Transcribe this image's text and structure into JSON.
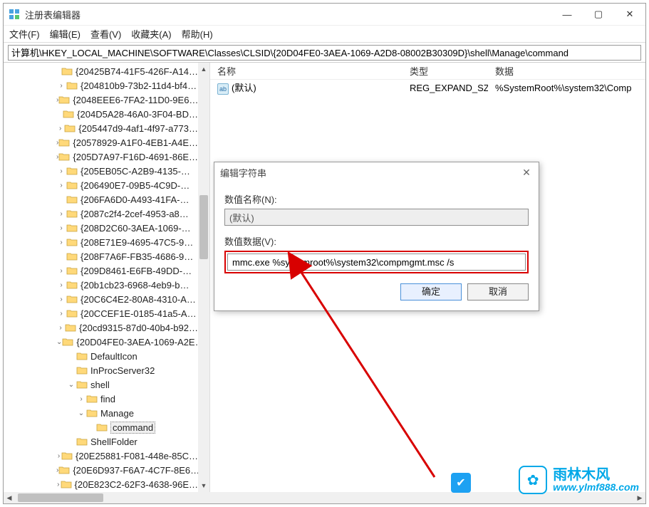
{
  "window": {
    "title": "注册表编辑器",
    "minimize": "—",
    "maximize": "▢",
    "close": "✕"
  },
  "menu": {
    "file": "文件(F)",
    "edit": "编辑(E)",
    "view": "查看(V)",
    "fav": "收藏夹(A)",
    "help": "帮助(H)"
  },
  "path": "计算机\\HKEY_LOCAL_MACHINE\\SOFTWARE\\Classes\\CLSID\\{20D04FE0-3AEA-1069-A2D8-08002B30309D}\\shell\\Manage\\command",
  "list": {
    "headers": {
      "name": "名称",
      "type": "类型",
      "data": "数据"
    },
    "rows": [
      {
        "icon": "ab",
        "name": "(默认)",
        "type": "REG_EXPAND_SZ",
        "data": "%SystemRoot%\\system32\\Comp"
      }
    ]
  },
  "tree": {
    "items": [
      {
        "indent": 5,
        "caret": "",
        "label": "{20425B74-41F5-426F-A14…"
      },
      {
        "indent": 5,
        "caret": "›",
        "label": "{204810b9-73b2-11d4-bf4…"
      },
      {
        "indent": 5,
        "caret": "›",
        "label": "{2048EEE6-7FA2-11D0-9E6…"
      },
      {
        "indent": 5,
        "caret": "",
        "label": "{204D5A28-46A0-3F04-BD…"
      },
      {
        "indent": 5,
        "caret": "›",
        "label": "{205447d9-4af1-4f97-a773…"
      },
      {
        "indent": 5,
        "caret": "›",
        "label": "{20578929-A1F0-4EB1-A4E…"
      },
      {
        "indent": 5,
        "caret": "›",
        "label": "{205D7A97-F16D-4691-86E…"
      },
      {
        "indent": 5,
        "caret": "›",
        "label": "{205EB05C-A2B9-4135-…"
      },
      {
        "indent": 5,
        "caret": "›",
        "label": "{206490E7-09B5-4C9D-…"
      },
      {
        "indent": 5,
        "caret": "",
        "label": "{206FA6D0-A493-41FA-…"
      },
      {
        "indent": 5,
        "caret": "›",
        "label": "{2087c2f4-2cef-4953-a8…"
      },
      {
        "indent": 5,
        "caret": "›",
        "label": "{208D2C60-3AEA-1069-…"
      },
      {
        "indent": 5,
        "caret": "›",
        "label": "{208E71E9-4695-47C5-9…"
      },
      {
        "indent": 5,
        "caret": "",
        "label": "{208F7A6F-FB35-4686-9…"
      },
      {
        "indent": 5,
        "caret": "›",
        "label": "{209D8461-E6FB-49DD-…"
      },
      {
        "indent": 5,
        "caret": "›",
        "label": "{20b1cb23-6968-4eb9-b…"
      },
      {
        "indent": 5,
        "caret": "›",
        "label": "{20C6C4E2-80A8-4310-A…"
      },
      {
        "indent": 5,
        "caret": "›",
        "label": "{20CCEF1E-0185-41a5-A…"
      },
      {
        "indent": 5,
        "caret": "›",
        "label": "{20cd9315-87d0-40b4-b92…"
      },
      {
        "indent": 5,
        "caret": "⌄",
        "label": "{20D04FE0-3AEA-1069-A2E…"
      },
      {
        "indent": 6,
        "caret": "",
        "label": "DefaultIcon"
      },
      {
        "indent": 6,
        "caret": "",
        "label": "InProcServer32"
      },
      {
        "indent": 6,
        "caret": "⌄",
        "label": "shell"
      },
      {
        "indent": 7,
        "caret": "›",
        "label": "find"
      },
      {
        "indent": 7,
        "caret": "⌄",
        "label": "Manage"
      },
      {
        "indent": 8,
        "caret": "",
        "label": "command",
        "selected": true
      },
      {
        "indent": 6,
        "caret": "",
        "label": "ShellFolder"
      },
      {
        "indent": 5,
        "caret": "›",
        "label": "{20E25881-F081-448e-85C…"
      },
      {
        "indent": 5,
        "caret": "›",
        "label": "{20E6D937-F6A7-4C7F-8E6…"
      },
      {
        "indent": 5,
        "caret": "›",
        "label": "{20E823C2-62F3-4638-96E…"
      }
    ]
  },
  "dialog": {
    "title": "编辑字符串",
    "name_label": "数值名称(N):",
    "name_value": "(默认)",
    "data_label": "数值数据(V):",
    "data_value": "mmc.exe %systemroot%\\system32\\compmgmt.msc /s",
    "ok": "确定",
    "cancel": "取消"
  },
  "watermark": {
    "brand": "雨林木风",
    "url": "www.ylmf888.com"
  }
}
